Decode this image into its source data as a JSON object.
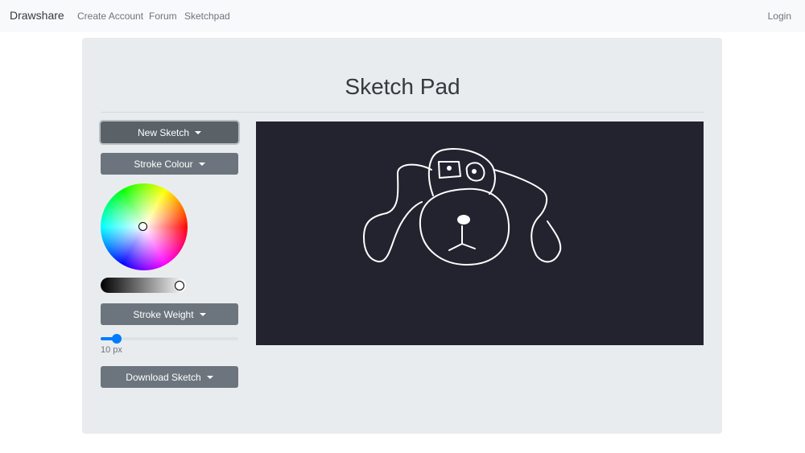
{
  "navbar": {
    "brand": "Drawshare",
    "links": [
      "Create Account",
      "Forum",
      "Sketchpad"
    ],
    "login": "Login"
  },
  "page": {
    "title": "Sketch Pad"
  },
  "controls": {
    "new_sketch": "New Sketch",
    "stroke_colour": "Stroke Colour",
    "stroke_weight": "Stroke Weight",
    "stroke_weight_value": 10,
    "stroke_weight_min": 1,
    "stroke_weight_max": 100,
    "stroke_weight_label": "10 px",
    "lightness_level": 1.0,
    "download_sketch": "Download Sketch"
  },
  "colors": {
    "canvas_background": "#232330",
    "stroke": "#ffffff",
    "button": "#6c757d",
    "slider_accent": "#007bff"
  }
}
